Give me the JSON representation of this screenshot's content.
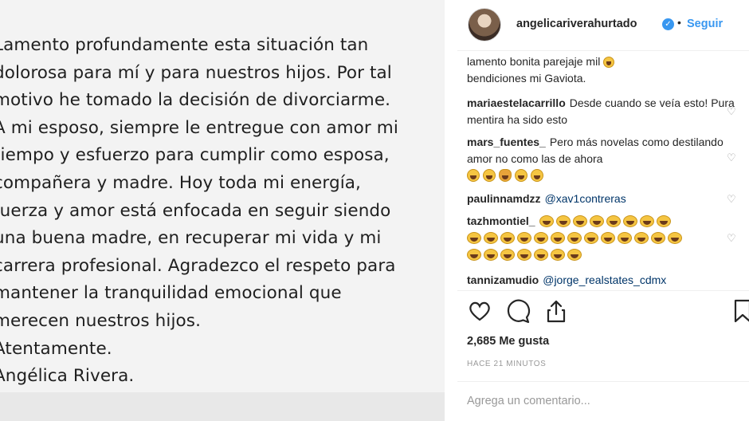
{
  "post": {
    "letter_lines": [
      "Lamento profundamente esta situación tan",
      "dolorosa para mí y para nuestros hijos. Por tal",
      "motivo he tomado la decisión de divorciarme.",
      "A mi esposo, siempre le entregue con amor mi",
      "tiempo y esfuerzo para cumplir como esposa,",
      "compañera y madre. Hoy toda mi energía,",
      "fuerza y amor está enfocada en seguir siendo",
      "una buena madre, en recuperar mi vida y mi",
      "carrera profesional. Agradezco el respeto para",
      "mantener la tranquilidad emocional que",
      "merecen nuestros hijos.",
      "Atentamente.",
      "Angélica Rivera."
    ]
  },
  "header": {
    "username": "angelicariverahurtado",
    "separator": "•",
    "follow_label": "Seguir"
  },
  "comments": [
    {
      "user": "",
      "text": "lamento bonita parejaje mil",
      "text2": "bendiciones mi Gaviota."
    },
    {
      "user": "mariaestelacarrillo",
      "text": "Desde cuando se veía esto! Pura mentira ha sido esto"
    },
    {
      "user": "mars_fuentes_",
      "text": "Pero más novelas como destilando amor no como las de ahora"
    },
    {
      "user": "paulinnamdzz",
      "text": "@xav1contreras"
    },
    {
      "user": "tazhmontiel_",
      "text": ""
    },
    {
      "user": "tannizamudio",
      "text": "@jorge_realstates_cdmx"
    }
  ],
  "likes": "2,685 Me gusta",
  "timestamp": "HACE 21 MINUTOS",
  "comment_placeholder": "Agrega un comentario...",
  "icons": [
    "heart-icon",
    "comment-icon",
    "share-icon",
    "bookmark-icon",
    "verified-icon"
  ],
  "colors": {
    "accent": "#3897f0",
    "text": "#262626",
    "muted": "#999999"
  }
}
